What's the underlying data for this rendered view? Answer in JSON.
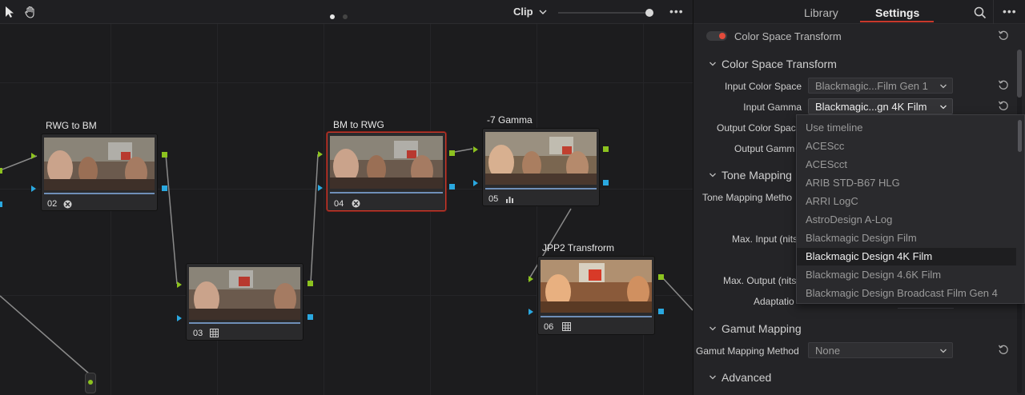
{
  "node_editor": {
    "toolbar": {
      "pointer_icon": "pointer-icon",
      "hand_icon": "hand-icon",
      "clip_label": "Clip",
      "more_label": "•••"
    },
    "nodes": [
      {
        "id": "n02",
        "title": "RWG to BM",
        "number": "02",
        "badge": "fx-icon"
      },
      {
        "id": "n03",
        "title": "",
        "number": "03",
        "badge": "grid-icon"
      },
      {
        "id": "n04",
        "title": "BM to RWG",
        "number": "04",
        "badge": "fx-icon",
        "selected": true
      },
      {
        "id": "n05",
        "title": "-7 Gamma",
        "number": "05",
        "badge": "bars-icon"
      },
      {
        "id": "n06",
        "title": "JPP2 Transfrorm",
        "number": "06",
        "badge": "grid-icon"
      }
    ]
  },
  "panel": {
    "tabs": [
      {
        "label": "Library",
        "active": false
      },
      {
        "label": "Settings",
        "active": true
      }
    ],
    "more_label": "•••",
    "plugin_name": "Color Space Transform",
    "sections": {
      "cst_title": "Color Space Transform",
      "tone_title": "Tone Mapping",
      "gamut_title": "Gamut Mapping",
      "advanced_title": "Advanced"
    },
    "fields": {
      "input_color_space_label": "Input Color Space",
      "input_color_space_value": "Blackmagic...Film Gen 1",
      "input_gamma_label": "Input Gamma",
      "input_gamma_value": "Blackmagic...gn 4K Film",
      "output_color_space_label": "Output Color Spac",
      "output_gamma_label": "Output Gamm",
      "tone_mapping_method_label": "Tone Mapping Metho",
      "max_input_label": "Max. Input (nits",
      "max_output_label": "Max. Output (nits",
      "adaptation_label": "Adaptatio",
      "gamut_mapping_method_label": "Gamut Mapping Method",
      "gamut_mapping_method_value": "None"
    },
    "dropdown_list": {
      "items": [
        "Use timeline",
        "ACEScc",
        "ACEScct",
        "ARIB STD-B67 HLG",
        "ARRI LogC",
        "AstroDesign A-Log",
        "Blackmagic Design Film",
        "Blackmagic Design 4K Film",
        "Blackmagic Design 4.6K Film",
        "Blackmagic Design Broadcast Film Gen 4"
      ],
      "selected": "Blackmagic Design 4K Film"
    }
  },
  "colors": {
    "accent_red": "#c8392b",
    "port_green": "#8cc21f",
    "port_blue": "#2aa8e0"
  }
}
